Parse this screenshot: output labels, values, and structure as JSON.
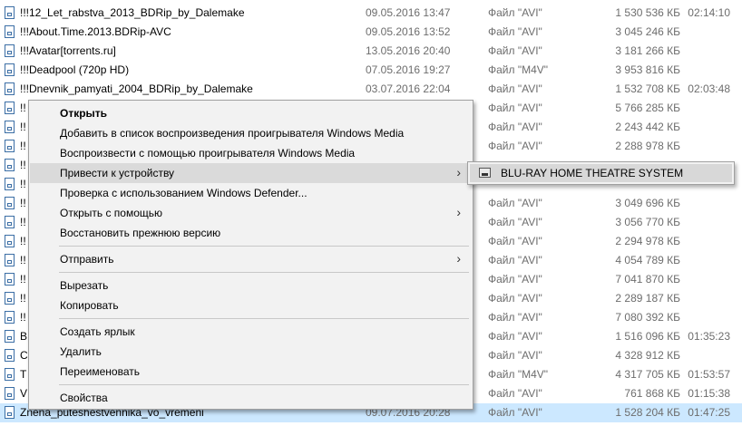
{
  "file_list": {
    "rows": [
      {
        "name": "!!!12_Let_rabstva_2013_BDRip_by_Dalemake",
        "date": "09.05.2016 13:47",
        "type": "Файл \"AVI\"",
        "size": "1 530 536 КБ",
        "duration": "02:14:10"
      },
      {
        "name": "!!!About.Time.2013.BDRip-AVC",
        "date": "09.05.2016 13:52",
        "type": "Файл \"AVI\"",
        "size": "3 045 246 КБ",
        "duration": ""
      },
      {
        "name": "!!!Avatar[torrents.ru]",
        "date": "13.05.2016 20:40",
        "type": "Файл \"AVI\"",
        "size": "3 181 266 КБ",
        "duration": ""
      },
      {
        "name": "!!!Deadpool (720p HD)",
        "date": "07.05.2016 19:27",
        "type": "Файл \"M4V\"",
        "size": "3 953 816 КБ",
        "duration": ""
      },
      {
        "name": "!!!Dnevnik_pamyati_2004_BDRip_by_Dalemake",
        "date": "03.07.2016 22:04",
        "type": "Файл \"AVI\"",
        "size": "1 532 708 КБ",
        "duration": "02:03:48"
      },
      {
        "name": "!!",
        "date": "",
        "type": "Файл \"AVI\"",
        "size": "5 766 285 КБ",
        "duration": ""
      },
      {
        "name": "!!",
        "date": "",
        "type": "Файл \"AVI\"",
        "size": "2 243 442 КБ",
        "duration": ""
      },
      {
        "name": "!!",
        "date": "",
        "type": "Файл \"AVI\"",
        "size": "2 288 978 КБ",
        "duration": ""
      },
      {
        "name": "!!",
        "date": "",
        "type": "",
        "size": "",
        "duration": ""
      },
      {
        "name": "!!",
        "date": "",
        "type": "",
        "size": "",
        "duration": ""
      },
      {
        "name": "!!",
        "date": "",
        "type": "Файл \"AVI\"",
        "size": "3 049 696 КБ",
        "duration": ""
      },
      {
        "name": "!!",
        "date": "",
        "type": "Файл \"AVI\"",
        "size": "3 056 770 КБ",
        "duration": ""
      },
      {
        "name": "!!",
        "date": "",
        "type": "Файл \"AVI\"",
        "size": "2 294 978 КБ",
        "duration": ""
      },
      {
        "name": "!!",
        "date": "",
        "type": "Файл \"AVI\"",
        "size": "4 054 789 КБ",
        "duration": ""
      },
      {
        "name": "!!",
        "date": "",
        "type": "Файл \"AVI\"",
        "size": "7 041 870 КБ",
        "duration": ""
      },
      {
        "name": "!!",
        "date": "",
        "type": "Файл \"AVI\"",
        "size": "2 289 187 КБ",
        "duration": ""
      },
      {
        "name": "!!",
        "date": "",
        "type": "Файл \"AVI\"",
        "size": "7 080 392 КБ",
        "duration": ""
      },
      {
        "name": "B",
        "date": "",
        "type": "Файл \"AVI\"",
        "size": "1 516 096 КБ",
        "duration": "01:35:23"
      },
      {
        "name": "C",
        "date": "",
        "type": "Файл \"AVI\"",
        "size": "4 328 912 КБ",
        "duration": ""
      },
      {
        "name": "T",
        "date": "",
        "type": "Файл \"M4V\"",
        "size": "4 317 705 КБ",
        "duration": "01:53:57"
      },
      {
        "name": "V",
        "date": "",
        "type": "Файл \"AVI\"",
        "size": "761 868 КБ",
        "duration": "01:15:38"
      },
      {
        "name": "Znena_puteshestvennika_vo_vremeni",
        "date": "09.07.2016 20:28",
        "type": "Файл \"AVI\"",
        "size": "1 528 204 КБ",
        "duration": "01:47:25"
      }
    ]
  },
  "context_menu": {
    "items": [
      {
        "label": "Открыть"
      },
      {
        "label": "Добавить в список воспроизведения проигрывателя Windows Media"
      },
      {
        "label": "Воспроизвести с помощью проигрывателя Windows Media"
      },
      {
        "label": "Привести к устройству"
      },
      {
        "label": "Проверка с использованием Windows Defender..."
      },
      {
        "label": "Открыть с помощью"
      },
      {
        "label": "Восстановить прежнюю версию"
      },
      {
        "label": "Отправить"
      },
      {
        "label": "Вырезать"
      },
      {
        "label": "Копировать"
      },
      {
        "label": "Создать ярлык"
      },
      {
        "label": "Удалить"
      },
      {
        "label": "Переименовать"
      },
      {
        "label": "Свойства"
      }
    ]
  },
  "submenu": {
    "items": [
      {
        "label": "BLU-RAY HOME THEATRE SYSTEM",
        "icon": "device-icon"
      }
    ]
  },
  "colors": {
    "selection": "#cce8ff",
    "menu_background": "#f2f2f2",
    "menu_highlight": "#dadada",
    "secondary_text": "#6d6d6d"
  }
}
